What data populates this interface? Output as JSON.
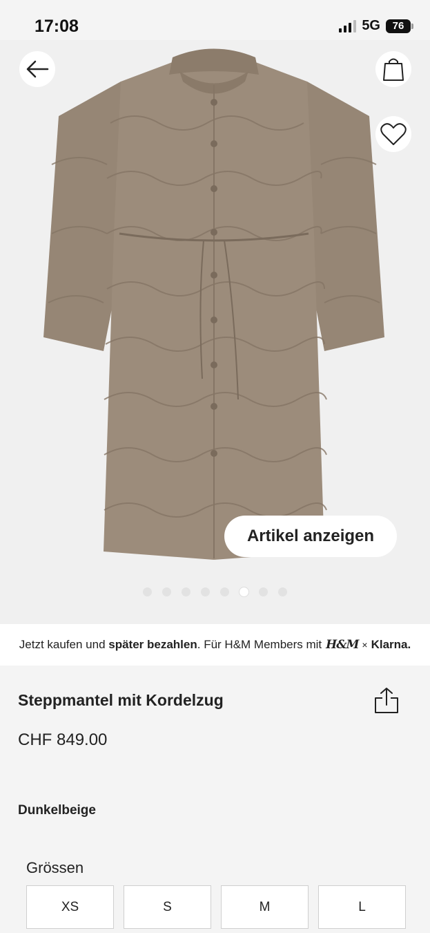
{
  "status_bar": {
    "time": "17:08",
    "network": "5G",
    "battery": "76"
  },
  "image_gallery": {
    "view_item_label": "Artikel anzeigen",
    "dot_count": 8,
    "active_dot": 5
  },
  "icons": {
    "back": "arrow-left-icon",
    "bag": "shopping-bag-icon",
    "favorite": "heart-icon",
    "share": "share-icon"
  },
  "promo": {
    "text_before": "Jetzt kaufen und ",
    "text_bold": "später bezahlen",
    "text_after": ". Für H&M Members mit",
    "hm_logo": "H&M",
    "times": "×",
    "klarna": "Klarna."
  },
  "product": {
    "title": "Steppmantel mit Kordelzug",
    "price": "CHF 849.00",
    "color": "Dunkelbeige"
  },
  "sizes": {
    "heading": "Grössen",
    "options": [
      "XS",
      "S",
      "M",
      "L"
    ]
  },
  "colors": {
    "coat": "#9c8c7b",
    "coat_shadow": "#857565",
    "background": "#f0f0f0"
  }
}
